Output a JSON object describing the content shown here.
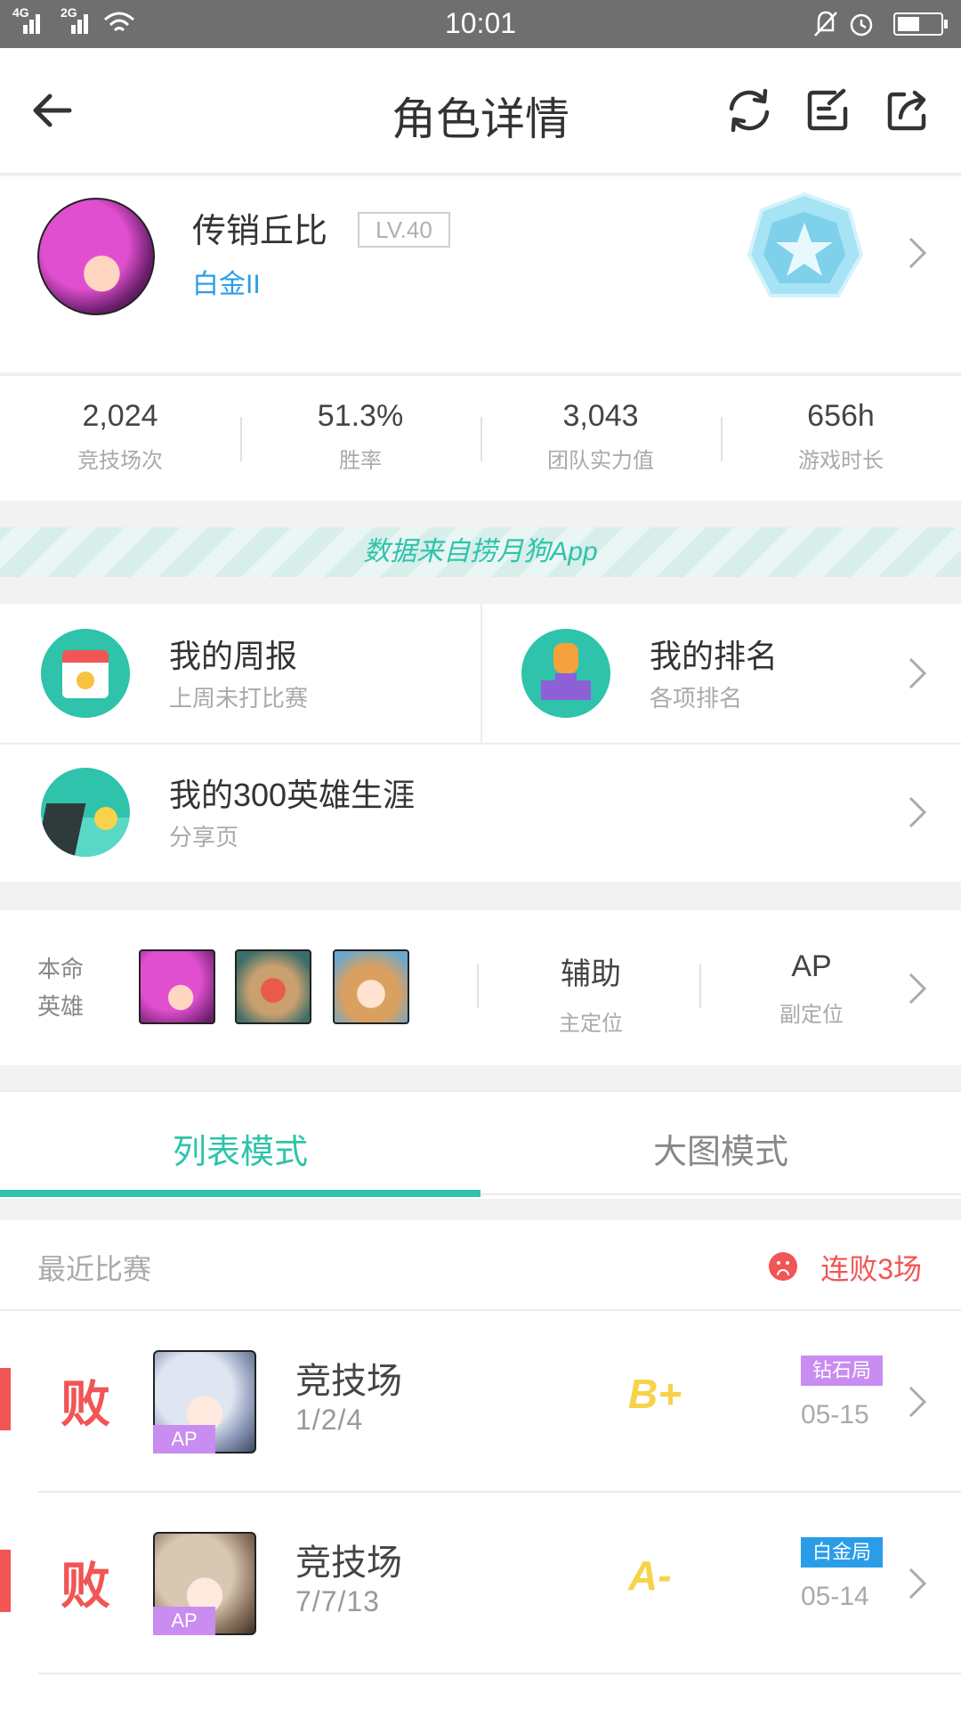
{
  "status": {
    "time": "10:01",
    "net1": "4G",
    "net2": "2G"
  },
  "header": {
    "title": "角色详情"
  },
  "profile": {
    "name": "传销丘比",
    "level": "LV.40",
    "rank": "白金II"
  },
  "stats": [
    {
      "value": "2,024",
      "label": "竞技场次"
    },
    {
      "value": "51.3%",
      "label": "胜率"
    },
    {
      "value": "3,043",
      "label": "团队实力值"
    },
    {
      "value": "656h",
      "label": "游戏时长"
    }
  ],
  "banner": {
    "text": "数据来自捞月狗App"
  },
  "cards": {
    "weekly": {
      "title": "我的周报",
      "sub": "上周未打比赛"
    },
    "ranking": {
      "title": "我的排名",
      "sub": "各项排名"
    },
    "career": {
      "title": "我的300英雄生涯",
      "sub": "分享页"
    }
  },
  "heroes": {
    "label_line1": "本命",
    "label_line2": "英雄",
    "primary_role": {
      "value": "辅助",
      "label": "主定位"
    },
    "secondary_role": {
      "value": "AP",
      "label": "副定位"
    }
  },
  "tabs": {
    "list": "列表模式",
    "big": "大图模式",
    "active": "list"
  },
  "recent": {
    "heading": "最近比赛",
    "streak": "连败3场",
    "matches": [
      {
        "result": "败",
        "tag": "AP",
        "mode": "竞技场",
        "kda": "1/2/4",
        "grade": "B+",
        "tier": "钻石局",
        "tier_color": "#c98cf0",
        "date": "05-15"
      },
      {
        "result": "败",
        "tag": "AP",
        "mode": "竞技场",
        "kda": "7/7/13",
        "grade": "A-",
        "tier": "白金局",
        "tier_color": "#2a9de8",
        "date": "05-14"
      }
    ]
  },
  "colors": {
    "accent": "#2ec3aa",
    "lose": "#f15555",
    "link": "#2a9de8"
  }
}
